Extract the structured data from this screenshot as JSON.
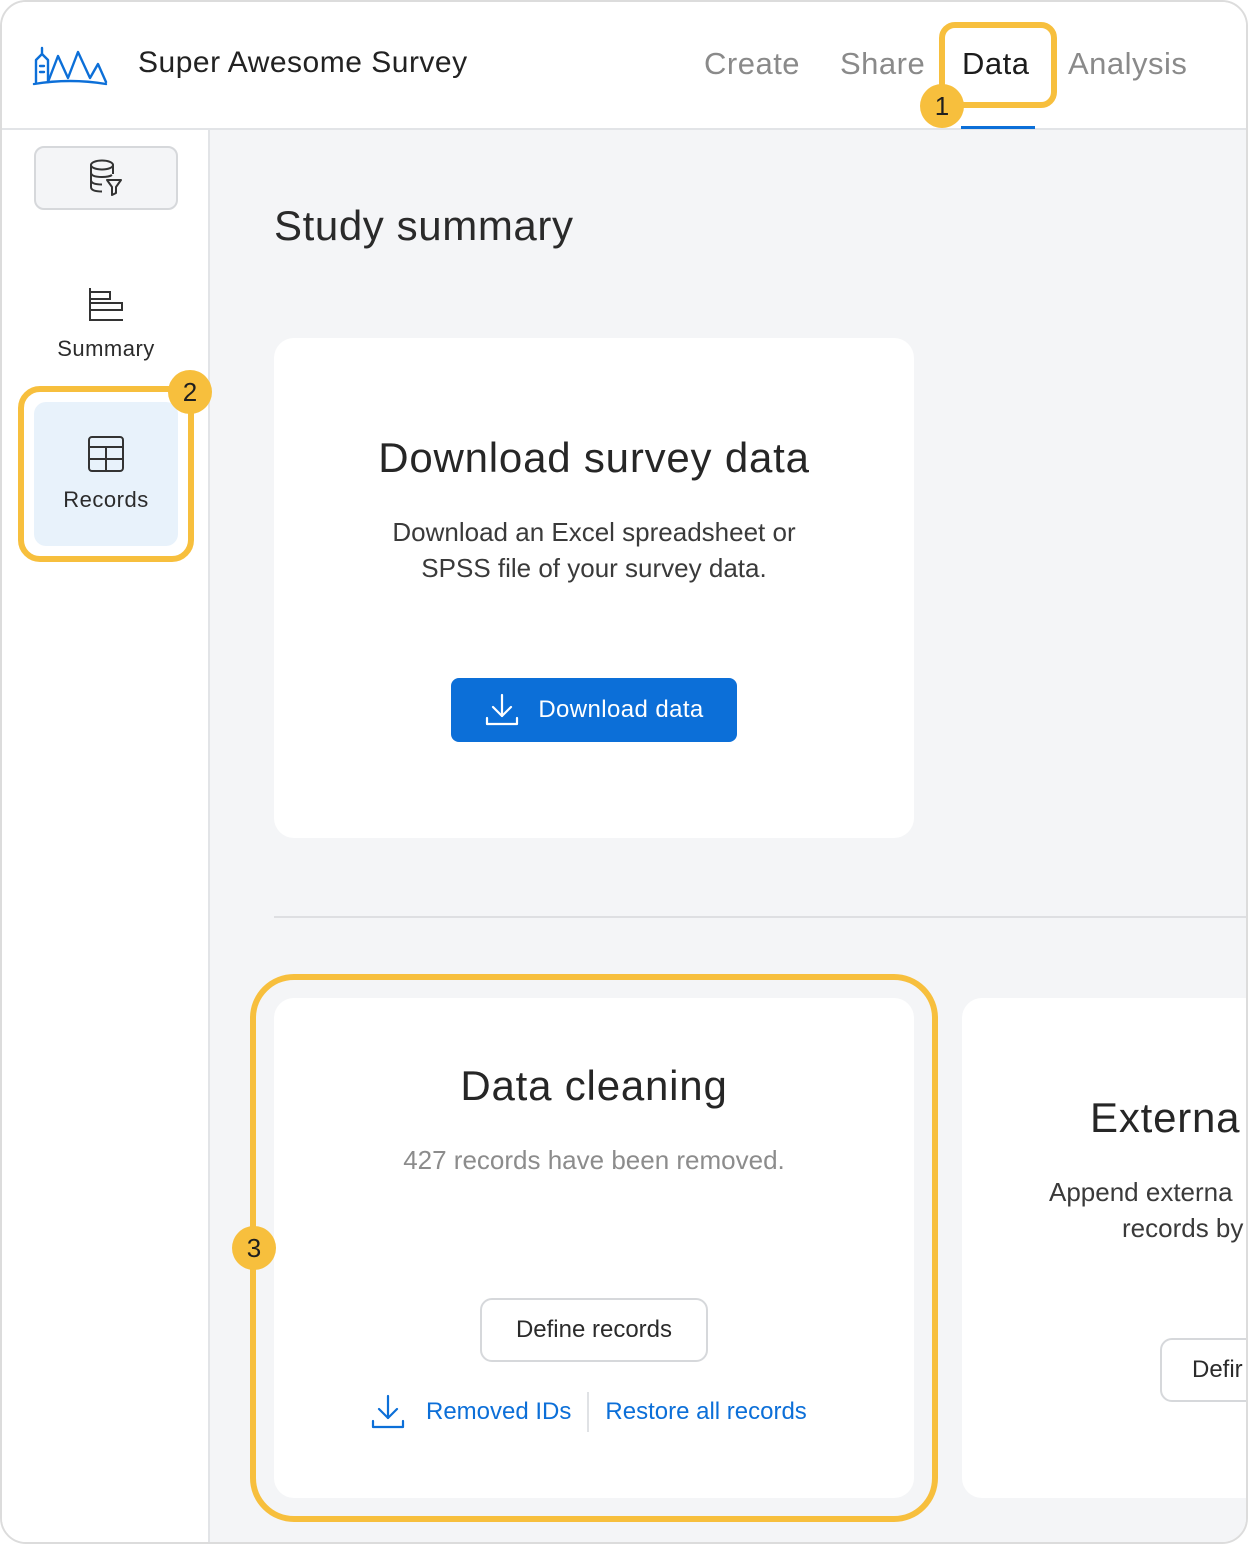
{
  "header": {
    "app_title": "Super Awesome Survey",
    "tabs": [
      {
        "label": "Create",
        "active": false
      },
      {
        "label": "Share",
        "active": false
      },
      {
        "label": "Data",
        "active": true
      },
      {
        "label": "Analysis",
        "active": false
      }
    ],
    "logo_icon": "mountains-logo-icon"
  },
  "sidebar": {
    "filter_icon": "database-filter-icon",
    "items": [
      {
        "label": "Summary",
        "icon": "summary-bars-icon",
        "selected": false
      },
      {
        "label": "Records",
        "icon": "table-icon",
        "selected": true
      }
    ]
  },
  "main": {
    "title": "Study summary",
    "download_card": {
      "title": "Download survey data",
      "description_line1": "Download an Excel spreadsheet or",
      "description_line2": "SPSS file of your survey data.",
      "button_label": "Download data",
      "button_icon": "download-icon"
    },
    "cleaning_card": {
      "title": "Data cleaning",
      "status": "427 records have been removed.",
      "define_button": "Define records",
      "removed_ids_link": "Removed IDs",
      "removed_ids_icon": "download-icon",
      "restore_link": "Restore all records"
    },
    "external_card": {
      "title_partial": "Externa",
      "description_line1": "Append externa",
      "description_line2": "records by",
      "button_partial": "Defir"
    }
  },
  "annotations": {
    "badges": [
      "1",
      "2",
      "3"
    ],
    "highlight_color": "#f7bf3d"
  },
  "colors": {
    "accent": "#0c6fd8",
    "selected_bg": "#e8f2fb",
    "page_bg": "#f4f5f7"
  }
}
